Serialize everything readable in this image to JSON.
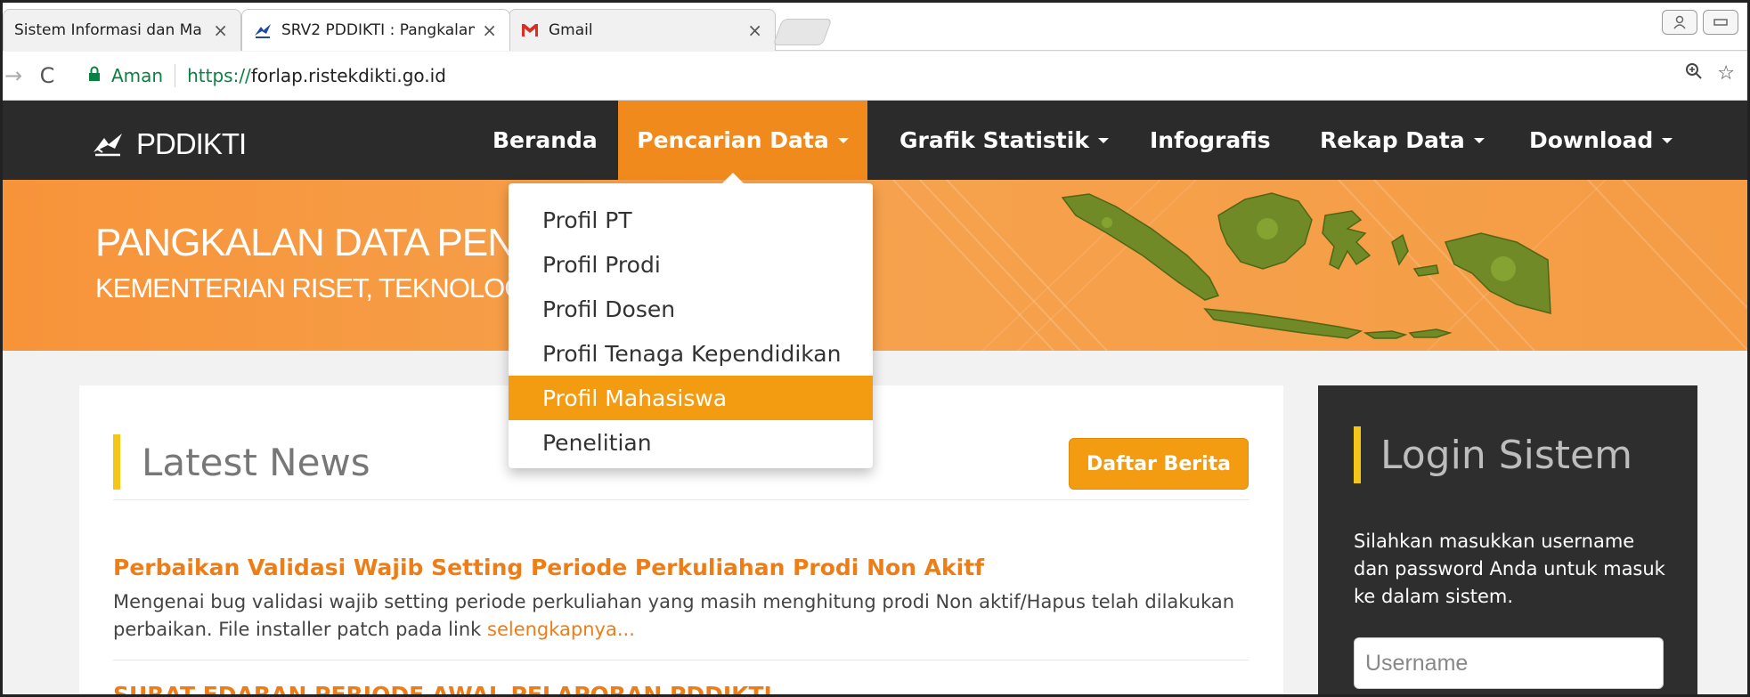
{
  "browser": {
    "tabs": [
      {
        "label": "Sistem Informasi dan Ma",
        "active": false
      },
      {
        "label": "SRV2 PDDIKTI : Pangkalan",
        "active": true
      },
      {
        "label": "Gmail",
        "active": false
      }
    ],
    "address": {
      "secure_label": "Aman",
      "url_scheme": "https://",
      "url_host": "forlap.ristekdikti.go.id"
    }
  },
  "navbar": {
    "brand": "PDDIKTI",
    "items": [
      {
        "label": "Beranda",
        "has_caret": false,
        "active": false
      },
      {
        "label": "Pencarian Data",
        "has_caret": true,
        "active": true
      },
      {
        "label": "Grafik Statistik",
        "has_caret": true,
        "active": false
      },
      {
        "label": "Infografis",
        "has_caret": false,
        "active": false
      },
      {
        "label": "Rekap Data",
        "has_caret": true,
        "active": false
      },
      {
        "label": "Download",
        "has_caret": true,
        "active": false
      }
    ]
  },
  "dropdown": {
    "items": [
      {
        "label": "Profil PT",
        "highlighted": false
      },
      {
        "label": "Profil Prodi",
        "highlighted": false
      },
      {
        "label": "Profil Dosen",
        "highlighted": false
      },
      {
        "label": "Profil Tenaga Kependidikan",
        "highlighted": false
      },
      {
        "label": "Profil Mahasiswa",
        "highlighted": true
      },
      {
        "label": "Penelitian",
        "highlighted": false
      }
    ]
  },
  "hero": {
    "title": "PANGKALAN DATA PEN",
    "subtitle": "KEMENTERIAN RISET, TEKNOLOG"
  },
  "news": {
    "heading": "Latest News",
    "list_button": "Daftar Berita",
    "items": [
      {
        "title": "Perbaikan Validasi Wajib Setting Periode Perkuliahan Prodi Non Akitf",
        "body": "Mengenai bug validasi wajib setting periode perkuliahan yang masih menghitung prodi Non aktif/Hapus telah dilakukan perbaikan. File installer patch pada link ",
        "more": "selengkapnya..."
      },
      {
        "title": "SURAT EDARAN PERIODE AWAL PELAPORAN PDDIKTI"
      }
    ]
  },
  "login": {
    "heading": "Login Sistem",
    "description": "Silahkan masukkan username dan password Anda untuk masuk ke dalam sistem.",
    "username_placeholder": "Username"
  },
  "colors": {
    "accent_orange": "#f18a1c",
    "highlight_orange": "#f39c12",
    "title_orange": "#ef7d15",
    "nav_dark": "#2b2b2b",
    "heading_bar_yellow": "#f5c518",
    "secure_green": "#0b8043"
  }
}
